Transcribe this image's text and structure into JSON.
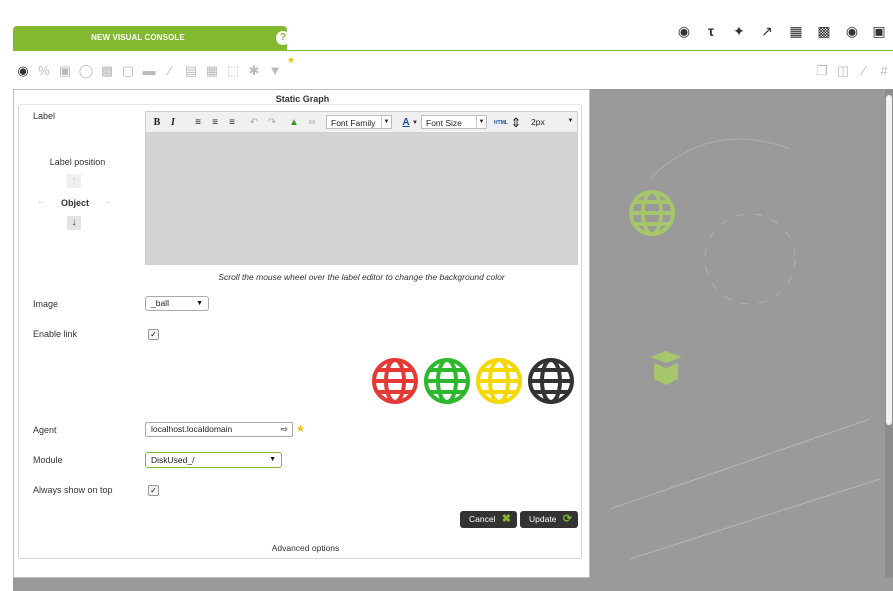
{
  "header": {
    "tab_title": "NEW VISUAL CONSOLE",
    "help_glyph": "?",
    "top_icons": [
      "eye-icon",
      "font-icon",
      "wand-icon",
      "wrench-icon",
      "list-icon",
      "chart-icon",
      "camera-icon",
      "monitor-icon"
    ]
  },
  "toolbar": {
    "icons": [
      "camera-icon",
      "percentile-icon",
      "module-graph-icon",
      "donut-icon",
      "bar-graph-icon",
      "auto-sla-icon",
      "label-icon",
      "line-icon",
      "box-icon",
      "network-icon",
      "group-icon",
      "asterisk-icon",
      "service-icon",
      "star-icon"
    ],
    "right_icons": [
      "copy-icon",
      "trash-icon",
      "wrench-icon",
      "grid-icon"
    ]
  },
  "dialog": {
    "title": "Static Graph",
    "label_caption": "Label",
    "label_position_caption": "Label position",
    "object_caption": "Object",
    "editor": {
      "font_family": "Font Family",
      "font_size": "Font Size",
      "line_height": "2px",
      "html_tag": "HTML"
    },
    "hint": "Scroll the mouse wheel over the label editor to change the background color",
    "image_caption": "Image",
    "image_value": "_ball",
    "enable_link_caption": "Enable link",
    "agent_caption": "Agent",
    "agent_value": "localhost.localdomain",
    "module_caption": "Module",
    "module_value": "DiskUsed_/",
    "always_on_top_caption": "Always show on top",
    "cancel_label": "Cancel",
    "update_label": "Update",
    "advanced_label": "Advanced options",
    "globe_colors": [
      "#e53935",
      "#2eb82e",
      "#f5d800",
      "#333333"
    ]
  },
  "colors": {
    "accent": "#82b92e",
    "canvas": "#9a9a9a"
  }
}
